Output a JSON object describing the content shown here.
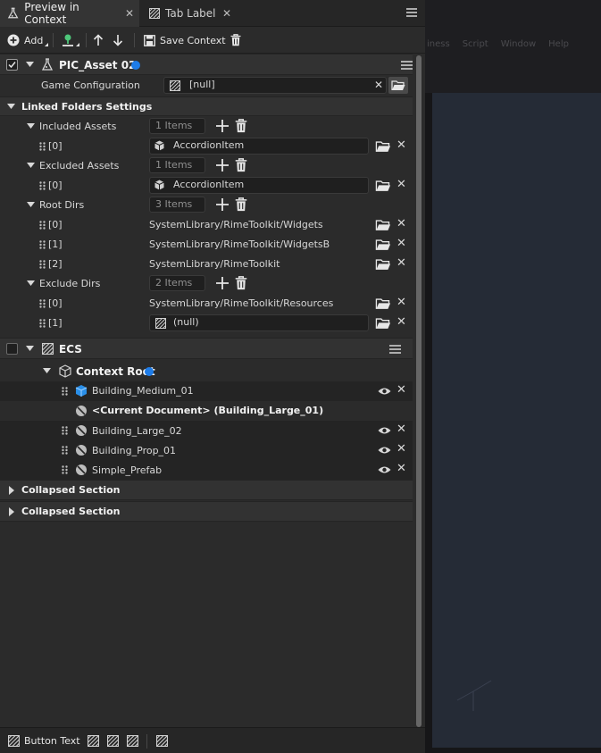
{
  "background_app": {
    "menu": [
      "iness",
      "Script",
      "Window",
      "Help"
    ]
  },
  "tabs": [
    {
      "label": "Preview in Context",
      "active": true
    },
    {
      "label": "Tab Label",
      "active": false
    }
  ],
  "toolbar": {
    "add_label": "Add",
    "save_context_label": "Save Context"
  },
  "asset": {
    "title": "PIC_Asset 02",
    "game_config_label": "Game Configuration",
    "game_config_value": "[null]"
  },
  "linked_folders": {
    "title": "Linked Folders Settings",
    "included": {
      "label": "Included Assets",
      "count": "1 Items",
      "items": [
        {
          "index": "[0]",
          "value": "AccordionItem"
        }
      ]
    },
    "excluded": {
      "label": "Excluded Assets",
      "count": "1 Items",
      "items": [
        {
          "index": "[0]",
          "value": "AccordionItem"
        }
      ]
    },
    "root_dirs": {
      "label": "Root Dirs",
      "count": "3 Items",
      "items": [
        {
          "index": "[0]",
          "value": "SystemLibrary/RimeToolkit/Widgets"
        },
        {
          "index": "[1]",
          "value": "SystemLibrary/RimeToolkit/WidgetsB"
        },
        {
          "index": "[2]",
          "value": "SystemLibrary/RimeToolkit"
        }
      ]
    },
    "exclude_dirs": {
      "label": "Exclude Dirs",
      "count": "2 Items",
      "items": [
        {
          "index": "[0]",
          "value": "SystemLibrary/RimeToolkit/Resources"
        },
        {
          "index": "[1]",
          "value": "(null)"
        }
      ]
    }
  },
  "ecs": {
    "title": "ECS",
    "context_root": "Context Root",
    "items": [
      {
        "label": "Building_Medium_01"
      },
      {
        "label": "<Current Document> (Building_Large_01)"
      },
      {
        "label": "Building_Large_02"
      },
      {
        "label": "Building_Prop_01"
      },
      {
        "label": "Simple_Prefab"
      }
    ]
  },
  "collapsed_sections": [
    "Collapsed Section",
    "Collapsed Section"
  ],
  "footer": {
    "button_text": "Button Text"
  },
  "colors": {
    "accent_blue": "#1e7ce8",
    "panel_bg": "#2b2b2b",
    "green_icon": "#4ec77a"
  }
}
